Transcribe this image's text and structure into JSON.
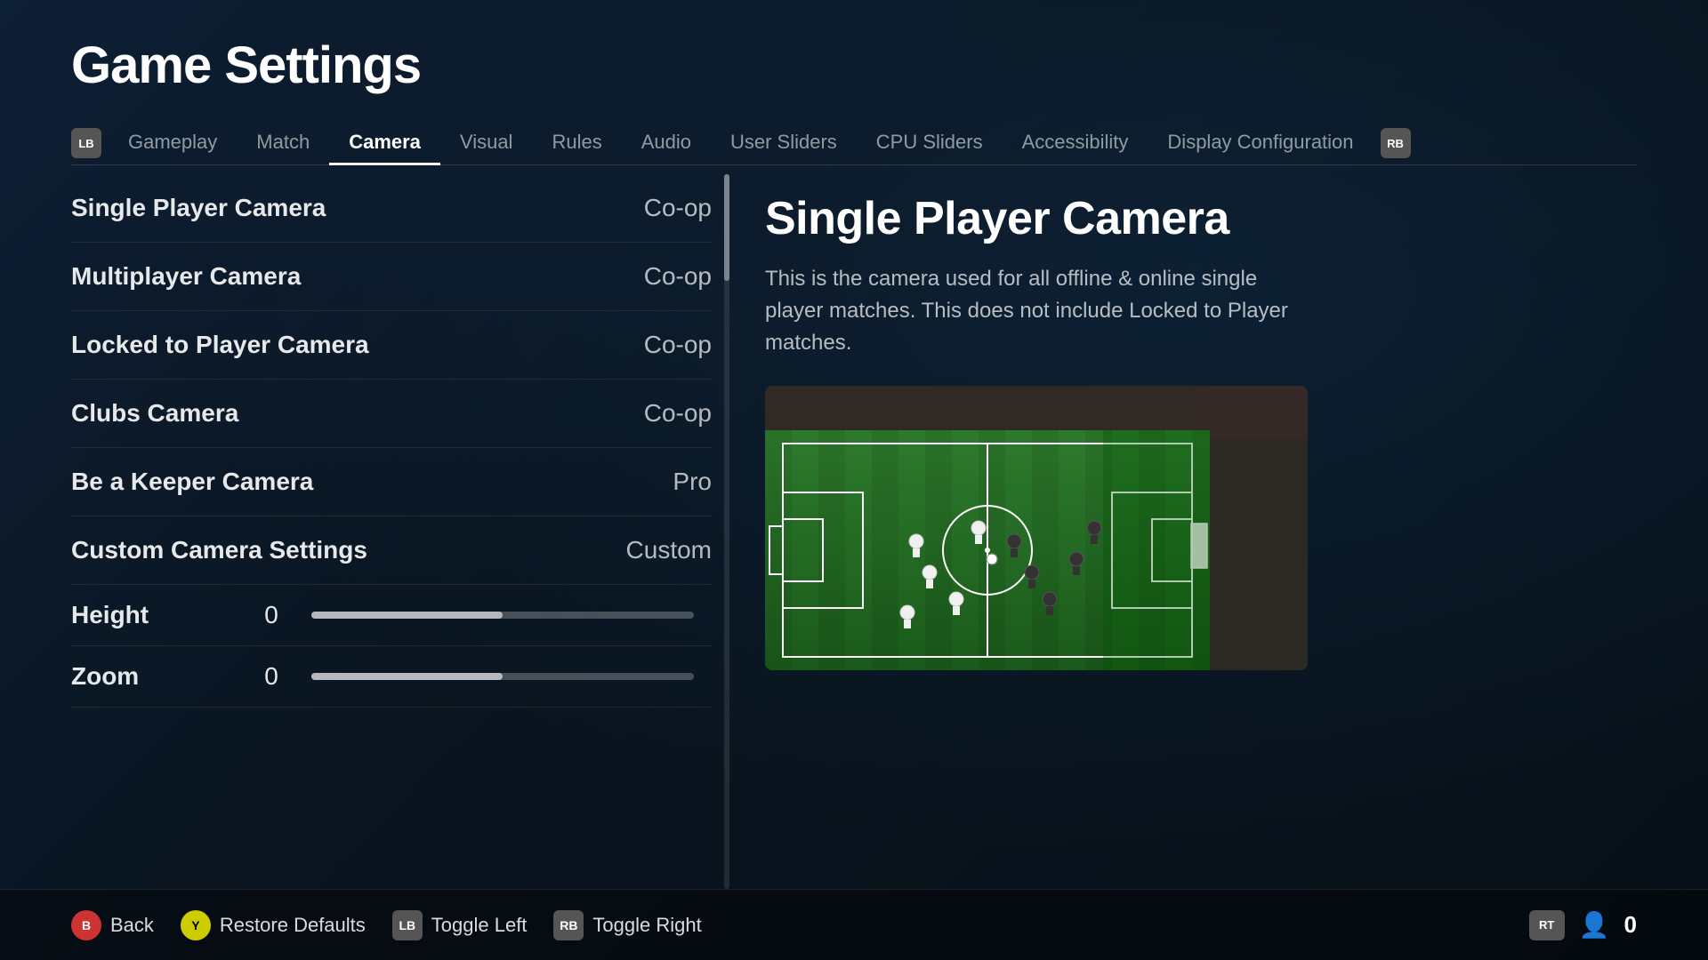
{
  "page": {
    "title": "Game Settings"
  },
  "nav": {
    "lb_label": "LB",
    "rb_label": "RB",
    "tabs": [
      {
        "id": "gameplay",
        "label": "Gameplay",
        "active": false
      },
      {
        "id": "match",
        "label": "Match",
        "active": false
      },
      {
        "id": "camera",
        "label": "Camera",
        "active": true
      },
      {
        "id": "visual",
        "label": "Visual",
        "active": false
      },
      {
        "id": "rules",
        "label": "Rules",
        "active": false
      },
      {
        "id": "audio",
        "label": "Audio",
        "active": false
      },
      {
        "id": "user-sliders",
        "label": "User Sliders",
        "active": false
      },
      {
        "id": "cpu-sliders",
        "label": "CPU Sliders",
        "active": false
      },
      {
        "id": "accessibility",
        "label": "Accessibility",
        "active": false
      },
      {
        "id": "display-configuration",
        "label": "Display Configuration",
        "active": false
      }
    ]
  },
  "settings": {
    "items": [
      {
        "id": "single-player-camera",
        "name": "Single Player Camera",
        "value": "Co-op"
      },
      {
        "id": "multiplayer-camera",
        "name": "Multiplayer Camera",
        "value": "Co-op"
      },
      {
        "id": "locked-to-player-camera",
        "name": "Locked to Player Camera",
        "value": "Co-op"
      },
      {
        "id": "clubs-camera",
        "name": "Clubs Camera",
        "value": "Co-op"
      },
      {
        "id": "be-a-keeper-camera",
        "name": "Be a Keeper Camera",
        "value": "Pro"
      },
      {
        "id": "custom-camera-settings",
        "name": "Custom Camera Settings",
        "value": "Custom"
      }
    ],
    "sliders": [
      {
        "id": "height",
        "name": "Height",
        "value": 0,
        "fill_percent": 50
      },
      {
        "id": "zoom",
        "name": "Zoom",
        "value": 0,
        "fill_percent": 50
      }
    ]
  },
  "detail": {
    "title": "Single Player Camera",
    "description": "This is the camera used for all offline & online single player matches. This does not include Locked to Player matches."
  },
  "footer": {
    "back_label": "Back",
    "restore_label": "Restore Defaults",
    "toggle_left_label": "Toggle Left",
    "toggle_right_label": "Toggle Right",
    "b_badge": "B",
    "y_badge": "Y",
    "lb_badge": "LB",
    "rb_badge": "RB",
    "rt_badge": "RT",
    "player_count": "0"
  },
  "scrollbar": {
    "visible": true
  }
}
